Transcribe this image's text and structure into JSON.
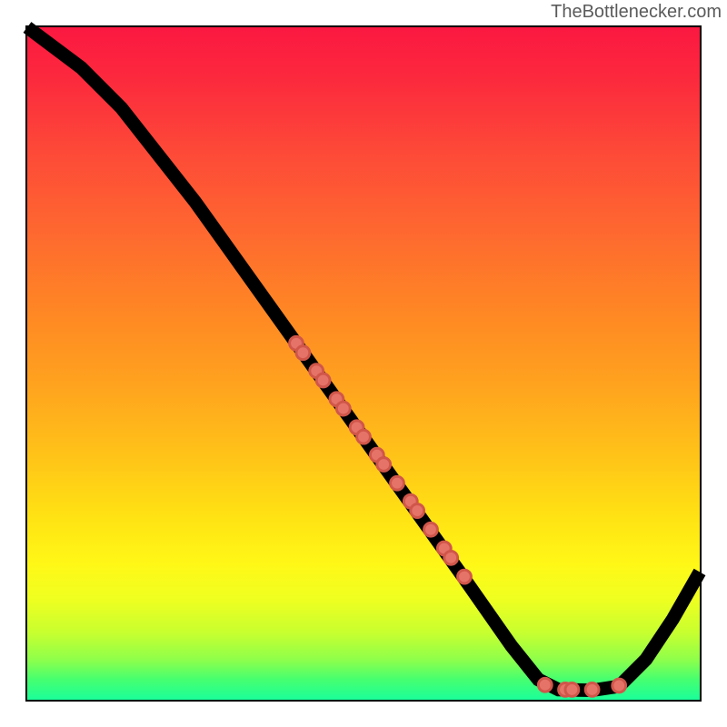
{
  "source_label": "TheBottlenecker.com",
  "chart_data": {
    "type": "line",
    "title": "",
    "xlabel": "",
    "ylabel": "",
    "xlim": [
      0,
      100
    ],
    "ylim": [
      0,
      100
    ],
    "curve": [
      {
        "x": 0,
        "y": 100
      },
      {
        "x": 8,
        "y": 94
      },
      {
        "x": 14,
        "y": 88
      },
      {
        "x": 25,
        "y": 74
      },
      {
        "x": 40,
        "y": 53
      },
      {
        "x": 55,
        "y": 32
      },
      {
        "x": 65,
        "y": 18
      },
      {
        "x": 72,
        "y": 8
      },
      {
        "x": 76,
        "y": 3
      },
      {
        "x": 79,
        "y": 1.5
      },
      {
        "x": 84,
        "y": 1.4
      },
      {
        "x": 88,
        "y": 2
      },
      {
        "x": 92,
        "y": 6
      },
      {
        "x": 96,
        "y": 12
      },
      {
        "x": 100,
        "y": 19
      }
    ],
    "series": [
      {
        "name": "cluster_midslope",
        "points": [
          {
            "x": 40,
            "y": 53
          },
          {
            "x": 41,
            "y": 51.6
          },
          {
            "x": 43,
            "y": 48.9
          },
          {
            "x": 44,
            "y": 47.5
          },
          {
            "x": 46,
            "y": 44.7
          },
          {
            "x": 47,
            "y": 43.3
          },
          {
            "x": 49,
            "y": 40.5
          },
          {
            "x": 50,
            "y": 39.1
          },
          {
            "x": 52,
            "y": 36.4
          },
          {
            "x": 53,
            "y": 35
          },
          {
            "x": 55,
            "y": 32.2
          },
          {
            "x": 57,
            "y": 29.5
          },
          {
            "x": 58,
            "y": 28.1
          },
          {
            "x": 60,
            "y": 25.3
          },
          {
            "x": 62,
            "y": 22.5
          },
          {
            "x": 63,
            "y": 21.1
          },
          {
            "x": 65,
            "y": 18.3
          }
        ]
      },
      {
        "name": "cluster_valley",
        "points": [
          {
            "x": 77,
            "y": 2.2
          },
          {
            "x": 80,
            "y": 1.5
          },
          {
            "x": 81,
            "y": 1.5
          },
          {
            "x": 84,
            "y": 1.5
          },
          {
            "x": 88,
            "y": 2.1
          }
        ]
      }
    ]
  }
}
